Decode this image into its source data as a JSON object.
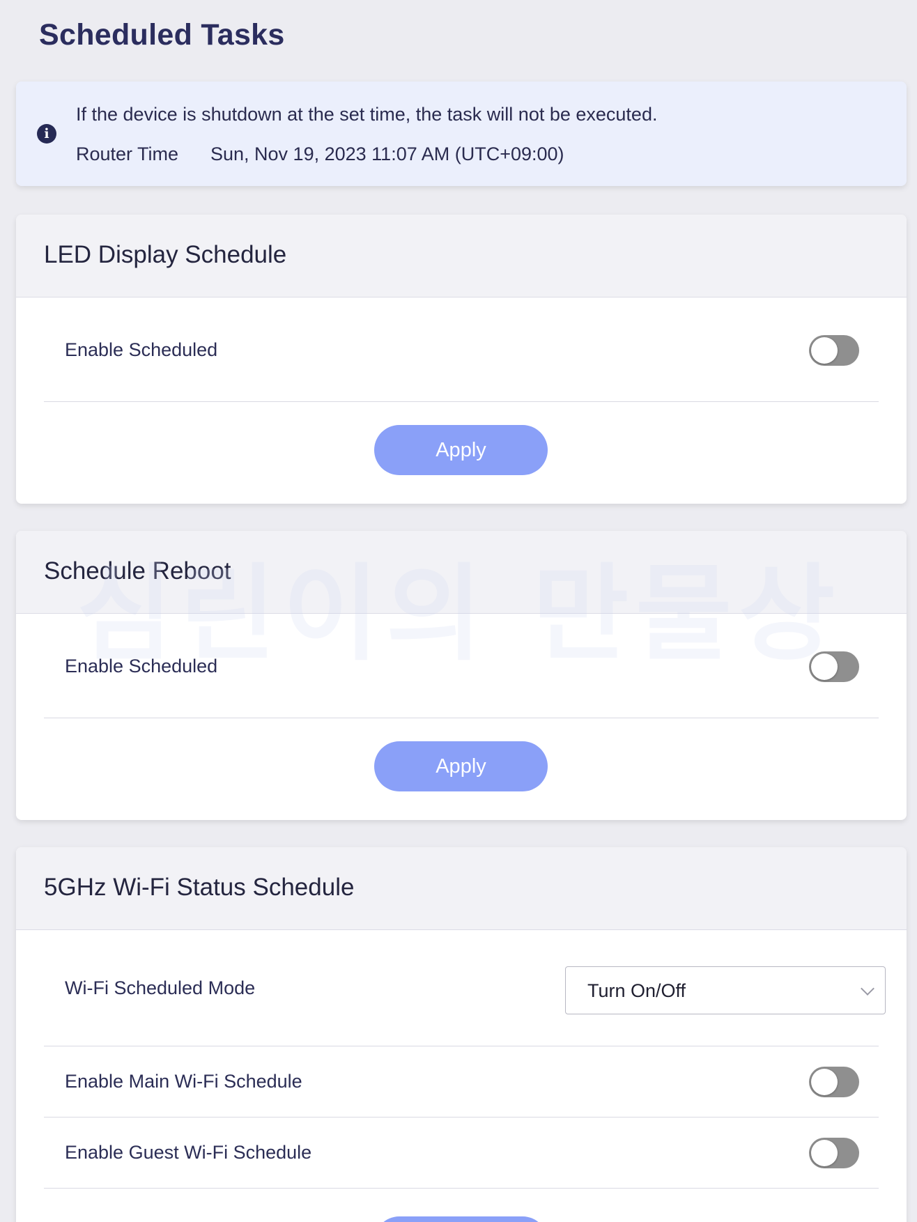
{
  "page": {
    "title": "Scheduled Tasks"
  },
  "info": {
    "message": "If the device is shutdown at the set time, the task will not be executed.",
    "time_label": "Router Time",
    "time_value": "Sun, Nov 19, 2023 11:07 AM (UTC+09:00)",
    "icon": "info-icon"
  },
  "led_schedule": {
    "title": "LED Display Schedule",
    "enable_label": "Enable Scheduled",
    "enabled": false,
    "apply_label": "Apply"
  },
  "reboot_schedule": {
    "title": "Schedule Reboot",
    "enable_label": "Enable Scheduled",
    "enabled": false,
    "apply_label": "Apply"
  },
  "wifi_schedule": {
    "title": "5GHz Wi-Fi Status Schedule",
    "mode_label": "Wi-Fi Scheduled Mode",
    "mode_value": "Turn On/Off",
    "main_label": "Enable Main Wi-Fi Schedule",
    "main_enabled": false,
    "guest_label": "Enable Guest Wi-Fi Schedule",
    "guest_enabled": false
  },
  "watermark": "심린이의 만물상",
  "colors": {
    "accent_button": "#8aa0f8",
    "title_color": "#2b2d5e",
    "info_background": "#ebeffc",
    "toggle_off": "#8f8f8f"
  }
}
